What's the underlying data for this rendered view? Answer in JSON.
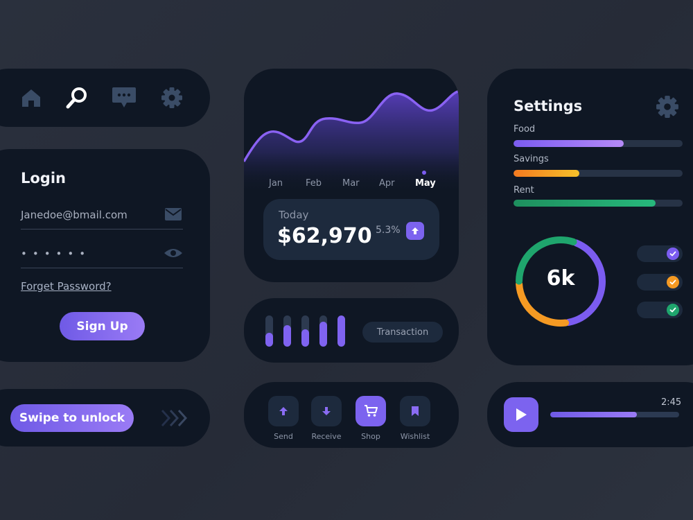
{
  "nav": {
    "icons": [
      "home-icon",
      "search-icon",
      "chat-icon",
      "gear-icon"
    ],
    "active": "search-icon"
  },
  "login": {
    "title": "Login",
    "email_value": "Janedoe@bmail.com",
    "password_value": "••••••",
    "forgot_label": "Forget Password?",
    "signup_label": "Sign Up"
  },
  "swipe": {
    "label": "Swipe to unlock"
  },
  "chart": {
    "months": [
      "Jan",
      "Feb",
      "Mar",
      "Apr",
      "May"
    ],
    "active_month": "May",
    "accent": "#7b5cf0"
  },
  "today": {
    "label": "Today",
    "value": "$62,970",
    "change": "5.3%"
  },
  "transactions": {
    "bar_levels": [
      0.45,
      0.7,
      0.55,
      0.8,
      1.0
    ],
    "label": "Transaction"
  },
  "actions": {
    "items": [
      {
        "label": "Send",
        "icon": "arrow-up-icon",
        "active": false
      },
      {
        "label": "Receive",
        "icon": "arrow-down-icon",
        "active": false
      },
      {
        "label": "Shop",
        "icon": "cart-icon",
        "active": true
      },
      {
        "label": "Wishlist",
        "icon": "bookmark-icon",
        "active": false
      }
    ]
  },
  "settings": {
    "title": "Settings",
    "budgets": [
      {
        "label": "Food",
        "level": 0.65,
        "colors": [
          "#7b5cf0",
          "#b58af6"
        ]
      },
      {
        "label": "Savings",
        "level": 0.39,
        "colors": [
          "#f47a20",
          "#f6c12a"
        ]
      },
      {
        "label": "Rent",
        "level": 0.84,
        "colors": [
          "#1e8f5e",
          "#27b87c"
        ]
      }
    ],
    "donut_value": "6k",
    "donut_segments": [
      {
        "color": "#7b5cf0",
        "share": 0.42
      },
      {
        "color": "#f59a23",
        "share": 0.27
      },
      {
        "color": "#1fa56d",
        "share": 0.31
      }
    ],
    "toggles": [
      {
        "color": "#7b5cf0",
        "on": true
      },
      {
        "color": "#f59a23",
        "on": true
      },
      {
        "color": "#1fa56d",
        "on": true
      }
    ]
  },
  "player": {
    "time": "2:45",
    "progress": 0.67
  }
}
